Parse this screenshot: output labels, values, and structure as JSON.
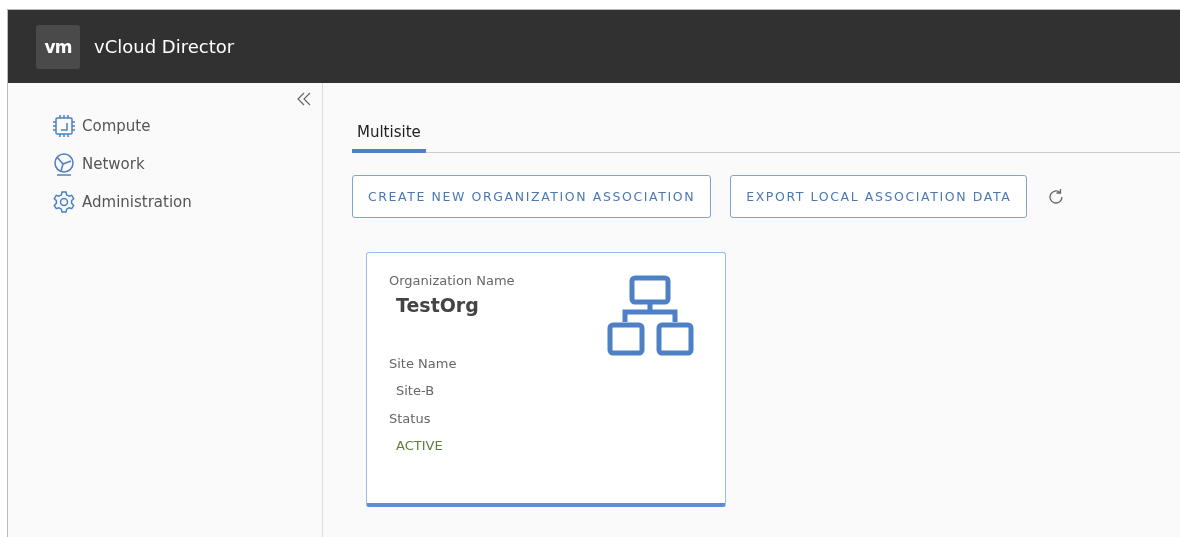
{
  "header": {
    "logo": "vm",
    "title": "vCloud Director"
  },
  "sidebar": {
    "items": [
      {
        "label": "Compute"
      },
      {
        "label": "Network"
      },
      {
        "label": "Administration"
      }
    ]
  },
  "tabs": [
    {
      "label": "Multisite",
      "selected": true
    }
  ],
  "actions": [
    "CREATE NEW ORGANIZATION ASSOCIATION",
    "EXPORT LOCAL ASSOCIATION DATA"
  ],
  "card": {
    "org_label": "Organization Name",
    "org_name": "TestOrg",
    "site_label": "Site Name",
    "site_name": "Site-B",
    "status_label": "Status",
    "status": {
      "text": "ACTIVE",
      "kind": "active"
    }
  }
}
